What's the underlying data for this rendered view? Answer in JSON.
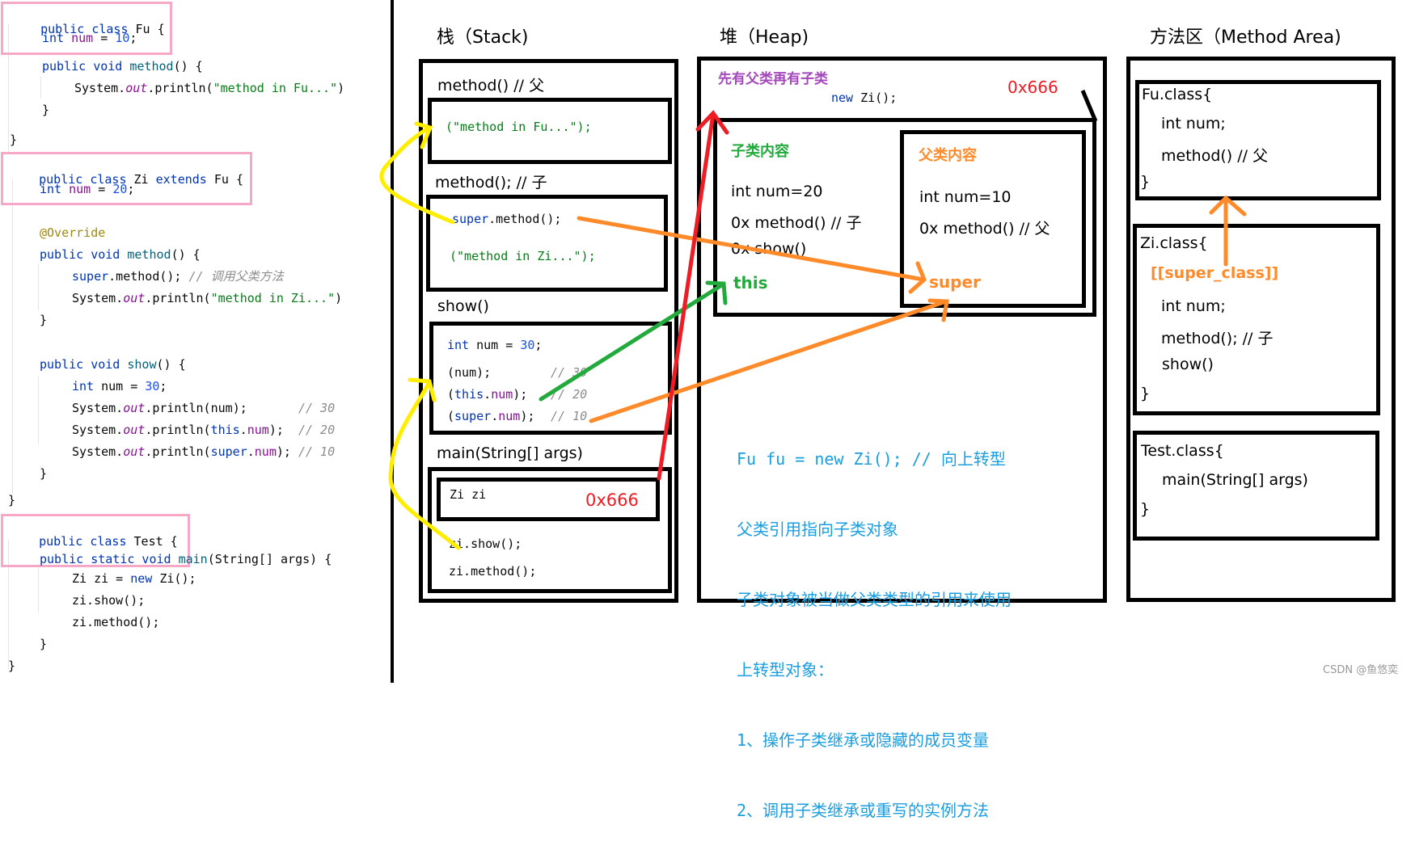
{
  "code_panel": {
    "fu_class": {
      "header": "public class Fu {",
      "field": {
        "type": "int",
        "name": "num",
        "value": "10"
      },
      "method_sig": {
        "mods": "public void",
        "name": "method",
        "rest": "() {"
      },
      "print_prefix": "System.",
      "print_out": "out",
      "print_call": ".println(",
      "print_str": "\"method in Fu...\"",
      "print_end": ")",
      "close_inner": "}",
      "close_outer": "}"
    },
    "zi_class": {
      "header": "public class Zi extends Fu {",
      "field": {
        "type": "int",
        "name": "num",
        "value": "20"
      },
      "annotation": "@Override",
      "method_sig": {
        "mods": "public void",
        "name": "method",
        "rest": "() {"
      },
      "super_call": {
        "kw": "super",
        "rest": ".method();",
        "comment": "// 调用父类方法"
      },
      "print_str": "\"method in Zi...\"",
      "show_sig": {
        "mods": "public void",
        "name": "show",
        "rest": "() {"
      },
      "local": {
        "type": "int",
        "rest": " num = ",
        "value": "30"
      },
      "prints": [
        {
          "arg_pre": "num",
          "arg_kw": "",
          "arg_fld": "",
          "pad": ");       ",
          "comment": "// 30"
        },
        {
          "arg_pre": "",
          "arg_kw": "this",
          "arg_fld": "num",
          "pad": ");  ",
          "comment": "// 20"
        },
        {
          "arg_pre": "",
          "arg_kw": "super",
          "arg_fld": "num",
          "pad": "); ",
          "comment": "// 10"
        }
      ],
      "close_inner": "}",
      "close_outer": "}"
    },
    "test_class": {
      "header": "public class Test {",
      "main_sig": {
        "mods": "public static void",
        "name": "main",
        "rest": "(String[] args) {"
      },
      "lines": [
        {
          "pre": "Zi zi = ",
          "kw": "new",
          "post": " Zi();"
        },
        {
          "pre": "zi.show();",
          "kw": "",
          "post": ""
        },
        {
          "pre": "zi.method();",
          "kw": "",
          "post": ""
        }
      ],
      "close_inner": "}",
      "close_outer": "}"
    }
  },
  "stack": {
    "title": "栈（Stack)",
    "frames": [
      {
        "label": "method() // 父",
        "lines": [
          "(\"method in Fu...\");"
        ]
      },
      {
        "label": "method(); // 子",
        "super_kw": "super",
        "super_rest": ".method();",
        "print": "(\"method in Zi...\");"
      },
      {
        "label": "show()",
        "local": {
          "type": "int",
          "rest": " num = ",
          "value": "30",
          "end": ";"
        },
        "prints": [
          {
            "pre": "(num);",
            "comment": "// 30"
          },
          {
            "kw": "this",
            "fld": "num",
            "comment": "// 20"
          },
          {
            "kw": "super",
            "fld": "num",
            "comment": "// 10"
          }
        ]
      },
      {
        "label": "main(String[] args)",
        "var": "Zi zi",
        "address": "0x666",
        "calls": [
          "zi.show();",
          "zi.method();"
        ]
      }
    ]
  },
  "heap": {
    "title": "堆（Heap)",
    "note": "先有父类再有子类",
    "new_kw": "new",
    "new_rest": " Zi();",
    "address": "0x666",
    "child": {
      "title": "子类内容",
      "lines": [
        "int num=20",
        "0x method() // 子",
        "0x show()"
      ],
      "ref": "this"
    },
    "parent": {
      "title": "父类内容",
      "lines": [
        "int num=10",
        "0x method() // 父"
      ],
      "ref": "super"
    },
    "explanation": [
      "Fu fu = new Zi(); // 向上转型",
      "父类引用指向子类对象",
      "子类对象被当做父类类型的引用来使用",
      "上转型对象：",
      "1、操作子类继承或隐藏的成员变量",
      "2、调用子类继承或重写的实例方法"
    ]
  },
  "method_area": {
    "title": "方法区（Method Area)",
    "classes": [
      {
        "name": "Fu.class{",
        "members": [
          "int num;",
          "method() // 父"
        ],
        "close": "}"
      },
      {
        "name": "Zi.class{",
        "super_ref": "[[super_class]]",
        "members": [
          "int num;",
          "method(); // 子",
          "show()"
        ],
        "close": "}"
      },
      {
        "name": "Test.class{",
        "members": [
          "main(String[] args)"
        ],
        "close": "}"
      }
    ]
  },
  "colors": {
    "yellow_arrow": "#ffee00",
    "orange_arrow": "#ff8a2a",
    "green_arrow": "#22aa3c",
    "red_arrow": "#ee1c24",
    "note_purple": "#a347ba",
    "child_green": "#22aa3c",
    "parent_orange": "#ff8a2a",
    "address_red": "#ee1c24",
    "note_blue": "#1a9ee0",
    "pink_highlight": "#f7a8c6"
  },
  "watermark": "CSDN @鱼悠奕"
}
